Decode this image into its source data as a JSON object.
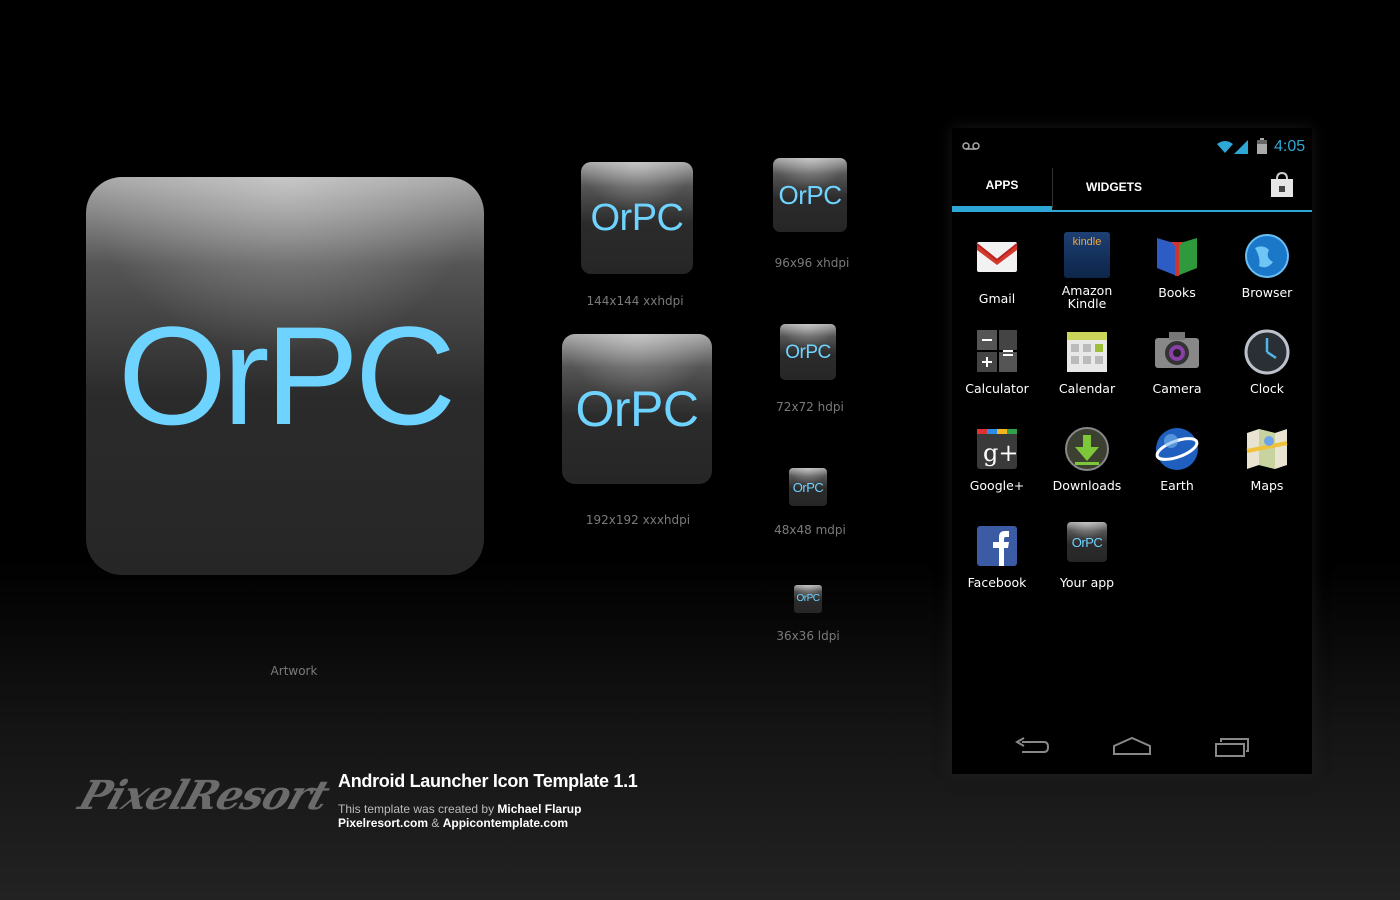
{
  "icon_text": "OrPC",
  "accent": "#6fd3ff",
  "artwork_label": "Artwork",
  "sizes": {
    "xxhdpi": "144x144 xxhdpi",
    "xhdpi": "96x96 xhdpi",
    "xxxhdpi": "192x192 xxxhdpi",
    "hdpi": "72x72 hdpi",
    "mdpi": "48x48 mdpi",
    "ldpi": "36x36 ldpi"
  },
  "footer": {
    "logo": "PixelResort",
    "title": "Android Launcher Icon Template 1.1",
    "credit_prefix": "This template was created by ",
    "credit_name": "Michael Flarup",
    "links_a": "Pixelresort.com",
    "links_sep": " & ",
    "links_b": "Appicontemplate.com"
  },
  "phone": {
    "time": "4:05",
    "tabs": [
      "APPS",
      "WIDGETS"
    ],
    "apps": [
      {
        "label": "Gmail",
        "icon": "gmail-icon"
      },
      {
        "label": "Amazon Kindle",
        "icon": "kindle-icon"
      },
      {
        "label": "Books",
        "icon": "books-icon"
      },
      {
        "label": "Browser",
        "icon": "browser-icon"
      },
      {
        "label": "Calculator",
        "icon": "calculator-icon"
      },
      {
        "label": "Calendar",
        "icon": "calendar-icon"
      },
      {
        "label": "Camera",
        "icon": "camera-icon"
      },
      {
        "label": "Clock",
        "icon": "clock-icon"
      },
      {
        "label": "Google+",
        "icon": "google-plus-icon"
      },
      {
        "label": "Downloads",
        "icon": "downloads-icon"
      },
      {
        "label": "Earth",
        "icon": "earth-icon"
      },
      {
        "label": "Maps",
        "icon": "maps-icon"
      },
      {
        "label": "Facebook",
        "icon": "facebook-icon"
      },
      {
        "label": "Your app",
        "icon": "your-app-icon"
      }
    ],
    "kindle_text": "kindle"
  }
}
